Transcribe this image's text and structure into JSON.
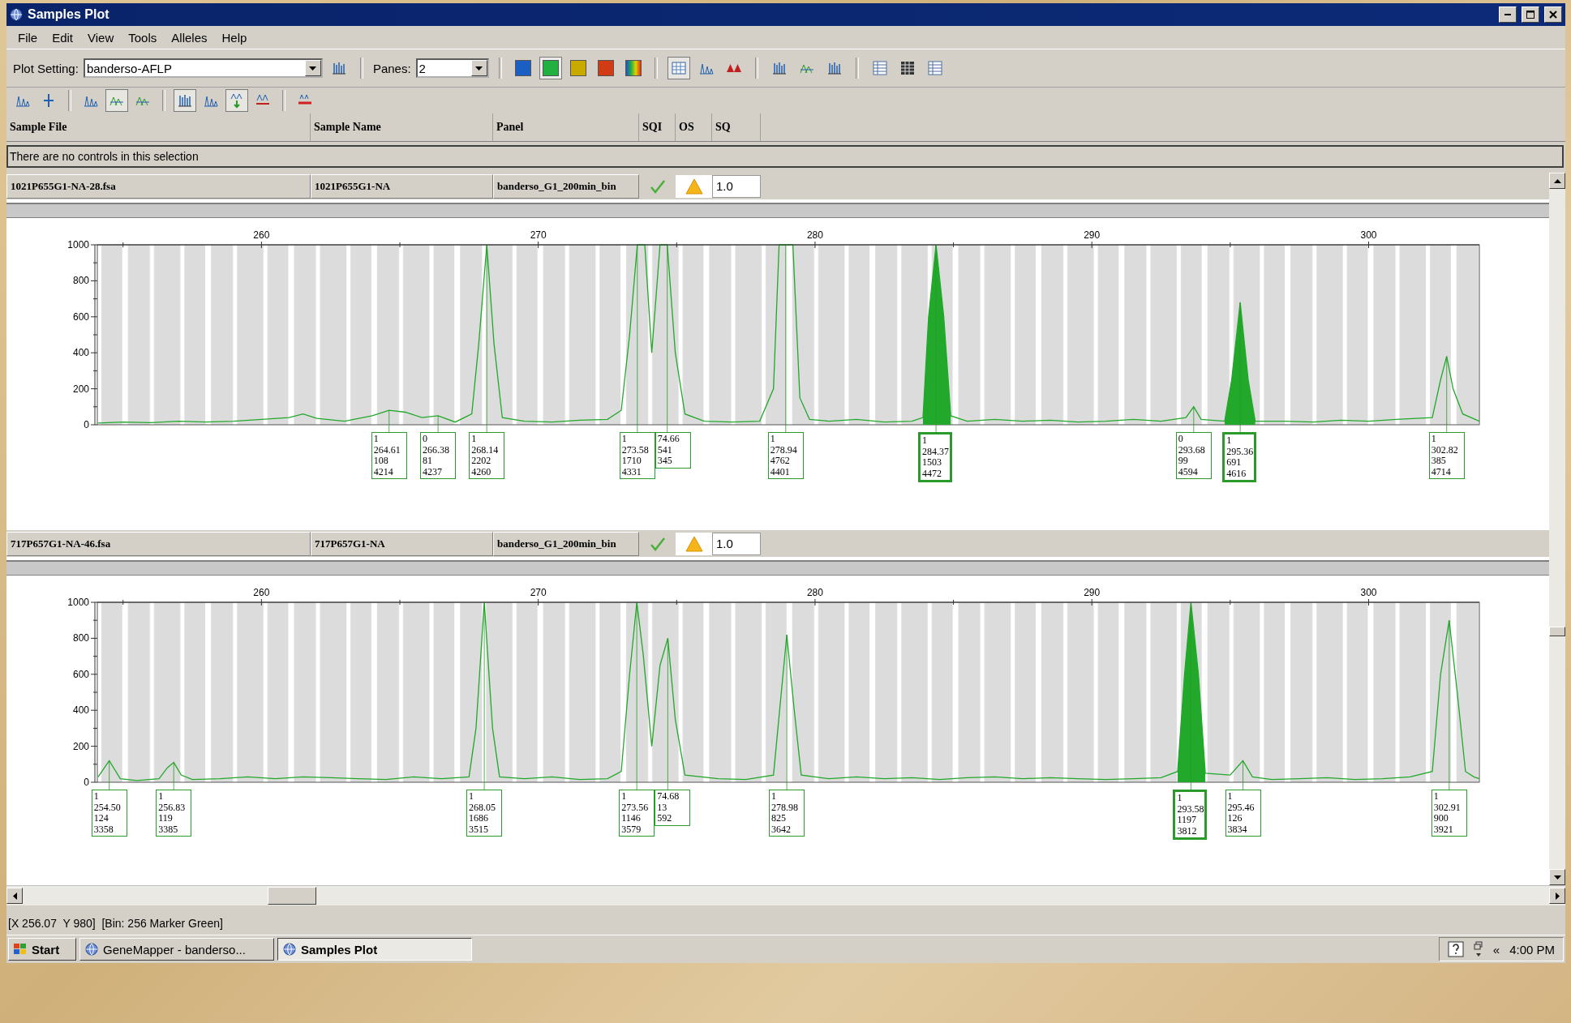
{
  "window": {
    "title": "Samples Plot"
  },
  "menu": [
    {
      "label": "File"
    },
    {
      "label": "Edit"
    },
    {
      "label": "View"
    },
    {
      "label": "Tools"
    },
    {
      "label": "Alleles"
    },
    {
      "label": "Help"
    }
  ],
  "toolbar": {
    "plot_setting_label": "Plot Setting:",
    "plot_setting": "banderso-AFLP",
    "panes_label": "Panes:",
    "panes": "2",
    "dyes": [
      {
        "kind": "dye",
        "color": "#1c5fc4",
        "selected": false
      },
      {
        "kind": "dye",
        "color": "#22b040",
        "selected": true
      },
      {
        "kind": "dye",
        "color": "#c8aa00",
        "selected": false
      },
      {
        "kind": "dye",
        "color": "#d23c14",
        "selected": false
      },
      {
        "kind": "all",
        "selected": false
      }
    ],
    "groups": [
      [
        {
          "kind": "grid",
          "selected": true
        },
        {
          "kind": "peaks",
          "selected": false
        },
        {
          "kind": "triangles",
          "selected": false
        }
      ],
      [
        {
          "kind": "bars",
          "selected": false
        },
        {
          "kind": "overlay",
          "selected": false
        },
        {
          "kind": "bars",
          "selected": false
        }
      ],
      [
        {
          "kind": "table",
          "selected": false
        },
        {
          "kind": "table-dark",
          "selected": false
        },
        {
          "kind": "table",
          "selected": false
        }
      ]
    ]
  },
  "toolbar2": [
    [
      {
        "kind": "peaks",
        "selected": false
      },
      {
        "kind": "pin",
        "selected": false
      }
    ],
    [
      {
        "kind": "peaks",
        "selected": false
      },
      {
        "kind": "overlay",
        "selected": true
      },
      {
        "kind": "overlay",
        "selected": false
      }
    ],
    [
      {
        "kind": "bars",
        "selected": true
      },
      {
        "kind": "peaks",
        "selected": false
      },
      {
        "kind": "arrow",
        "selected": true
      },
      {
        "kind": "strike",
        "selected": false
      }
    ],
    [
      {
        "kind": "range",
        "selected": false
      }
    ]
  ],
  "table": {
    "columns": [
      "Sample File",
      "Sample Name",
      "Panel",
      "SQI",
      "OS",
      "SQ"
    ],
    "notice": "There are no controls in this selection"
  },
  "panes": [
    {
      "sample_file": "1021P655G1-NA-28.fsa",
      "sample_name": "1021P655G1-NA",
      "panel": "banderso_G1_200min_bin",
      "sqi": {
        "kind": "check"
      },
      "os": {
        "kind": "warning"
      },
      "sq": "1.0",
      "chart_data": {
        "type": "line",
        "xlim": [
          254.07,
          304.0
        ],
        "ylim": [
          0,
          1000
        ],
        "xticks": [
          260,
          270,
          280,
          290,
          300
        ],
        "yticks": [
          0,
          200,
          400,
          600,
          800,
          1000
        ],
        "series": [
          {
            "color": "#22a82a",
            "x": [
              254.1,
              255,
              256,
              257,
              258,
              259,
              260,
              261,
              261.5,
              262,
              263,
              264,
              264.61,
              265.2,
              265.8,
              266.38,
              267,
              267.6,
              267.85,
              268.14,
              268.4,
              268.7,
              269.5,
              270.5,
              271.5,
              272.5,
              273.0,
              273.3,
              273.58,
              273.85,
              274.1,
              274.4,
              274.66,
              274.95,
              275.3,
              276,
              277,
              278,
              278.5,
              278.7,
              278.94,
              279.2,
              279.45,
              279.8,
              280.5,
              281.5,
              282.5,
              283.5,
              283.9,
              284.1,
              284.37,
              284.65,
              284.9,
              285.5,
              286.5,
              287.5,
              288.5,
              289.5,
              290.5,
              291.5,
              292.5,
              293.4,
              293.68,
              293.95,
              294.8,
              295.05,
              295.36,
              295.65,
              295.9,
              297,
              298,
              299,
              300,
              301,
              302.3,
              302.6,
              302.82,
              303.05,
              303.4,
              303.7,
              304
            ],
            "values": [
              10,
              15,
              12,
              20,
              15,
              20,
              30,
              40,
              60,
              35,
              20,
              50,
              80,
              70,
              40,
              50,
              15,
              60,
              450,
              1000,
              450,
              40,
              20,
              15,
              25,
              30,
              80,
              500,
              1000,
              1000,
              400,
              1000,
              1000,
              400,
              60,
              20,
              15,
              20,
              200,
              1000,
              1000,
              1000,
              150,
              30,
              20,
              30,
              15,
              20,
              40,
              600,
              1000,
              600,
              50,
              20,
              30,
              20,
              25,
              15,
              20,
              30,
              20,
              40,
              100,
              30,
              20,
              250,
              680,
              250,
              20,
              20,
              15,
              25,
              20,
              30,
              40,
              250,
              380,
              200,
              60,
              40,
              20
            ]
          },
          {
            "type": "area",
            "color": "#22a82a",
            "x": [
              283.9,
              284.1,
              284.37,
              284.65,
              284.9,
              290,
              294.8,
              295.05,
              295.36,
              295.65,
              295.9
            ],
            "values": [
              40,
              600,
              1000,
              600,
              50,
              null,
              20,
              250,
              680,
              250,
              20
            ]
          }
        ],
        "annotations": [
          {
            "x": 264.61,
            "y": 80,
            "text": "1\n264.61\n108\n4214"
          },
          {
            "x": 266.38,
            "y": 50,
            "text": "0\n266.38\n81\n4237"
          },
          {
            "x": 268.14,
            "y": 1000,
            "text": "1\n268.14\n2202\n4260"
          },
          {
            "x": 273.58,
            "y": 1000,
            "text": "1\n273.58\n1710\n4331"
          },
          {
            "x": 274.66,
            "y": 1000,
            "text": "74.66\n541\n345"
          },
          {
            "x": 278.94,
            "y": 1000,
            "text": "1\n278.94\n4762\n4401"
          },
          {
            "x": 284.37,
            "y": 1000,
            "text": "1\n284.37\n1503\n4472"
          },
          {
            "x": 293.68,
            "y": 100,
            "text": "0\n293.68\n99\n4594"
          },
          {
            "x": 295.36,
            "y": 680,
            "text": "1\n295.36\n691\n4616"
          },
          {
            "x": 302.82,
            "y": 380,
            "text": "1\n302.82\n385\n4714"
          }
        ]
      }
    },
    {
      "sample_file": "717P657G1-NA-46.fsa",
      "sample_name": "717P657G1-NA",
      "panel": "banderso_G1_200min_bin",
      "sqi": {
        "kind": "check"
      },
      "os": {
        "kind": "warning"
      },
      "sq": "1.0",
      "chart_data": {
        "type": "line",
        "xlim": [
          254.07,
          304.0
        ],
        "ylim": [
          0,
          1000
        ],
        "xticks": [
          260,
          270,
          280,
          290,
          300
        ],
        "yticks": [
          0,
          200,
          400,
          600,
          800,
          1000
        ],
        "series": [
          {
            "color": "#22a82a",
            "x": [
              254.1,
              254.5,
              254.9,
              255.5,
              256.3,
              256.6,
              256.83,
              257.1,
              257.5,
              258.5,
              259.5,
              260.5,
              261.5,
              262.5,
              263.5,
              264.5,
              265.5,
              266.5,
              267.5,
              267.75,
              268.05,
              268.35,
              268.6,
              269.5,
              270.5,
              271.5,
              272.5,
              273.0,
              273.3,
              273.56,
              273.8,
              274.1,
              274.4,
              274.68,
              274.95,
              275.3,
              276.5,
              277.5,
              278.5,
              278.75,
              278.98,
              279.25,
              279.5,
              280.5,
              281.5,
              282.5,
              283.5,
              284.5,
              285.5,
              286.5,
              287.5,
              288.5,
              289.5,
              290.5,
              291.5,
              292.5,
              293.1,
              293.35,
              293.58,
              293.85,
              294.1,
              295.0,
              295.46,
              295.8,
              296.5,
              297.5,
              298.5,
              299.5,
              300.5,
              301.5,
              302.3,
              302.6,
              302.91,
              303.2,
              303.5,
              303.8,
              304
            ],
            "values": [
              30,
              120,
              20,
              10,
              20,
              80,
              110,
              40,
              15,
              20,
              30,
              20,
              30,
              25,
              20,
              15,
              30,
              20,
              30,
              300,
              1000,
              300,
              30,
              20,
              30,
              15,
              20,
              60,
              600,
              1000,
              700,
              200,
              650,
              800,
              350,
              40,
              20,
              15,
              40,
              450,
              820,
              400,
              40,
              20,
              30,
              20,
              25,
              15,
              25,
              30,
              20,
              25,
              20,
              15,
              20,
              25,
              60,
              600,
              1000,
              600,
              50,
              40,
              120,
              30,
              15,
              20,
              25,
              15,
              20,
              30,
              60,
              600,
              900,
              500,
              60,
              30,
              20
            ]
          },
          {
            "type": "area",
            "color": "#22a82a",
            "x": [
              293.1,
              293.35,
              293.58,
              293.85,
              294.1
            ],
            "values": [
              60,
              600,
              1000,
              600,
              50
            ]
          }
        ],
        "annotations": [
          {
            "x": 254.5,
            "y": 120,
            "text": "1\n254.50\n124\n3358"
          },
          {
            "x": 256.83,
            "y": 110,
            "text": "1\n256.83\n119\n3385"
          },
          {
            "x": 268.05,
            "y": 1000,
            "text": "1\n268.05\n1686\n3515"
          },
          {
            "x": 273.56,
            "y": 1000,
            "text": "1\n273.56\n1146\n3579"
          },
          {
            "x": 274.68,
            "y": 800,
            "text": "74.68\n13\n592"
          },
          {
            "x": 278.98,
            "y": 820,
            "text": "1\n278.98\n825\n3642"
          },
          {
            "x": 293.58,
            "y": 1000,
            "text": "1\n293.58\n1197\n3812"
          },
          {
            "x": 295.46,
            "y": 120,
            "text": "1\n295.46\n126\n3834"
          },
          {
            "x": 302.91,
            "y": 900,
            "text": "1\n302.91\n900\n3921"
          }
        ]
      }
    }
  ],
  "status_bar": "[X 256.07  Y 980]  [Bin: 256 Marker Green]",
  "taskbar": {
    "start": "Start",
    "tasks": [
      {
        "label": "GeneMapper - banderso...",
        "selected": false
      },
      {
        "label": "Samples Plot",
        "selected": true
      }
    ],
    "tray_arrow": "«",
    "clock": "4:00 PM"
  }
}
